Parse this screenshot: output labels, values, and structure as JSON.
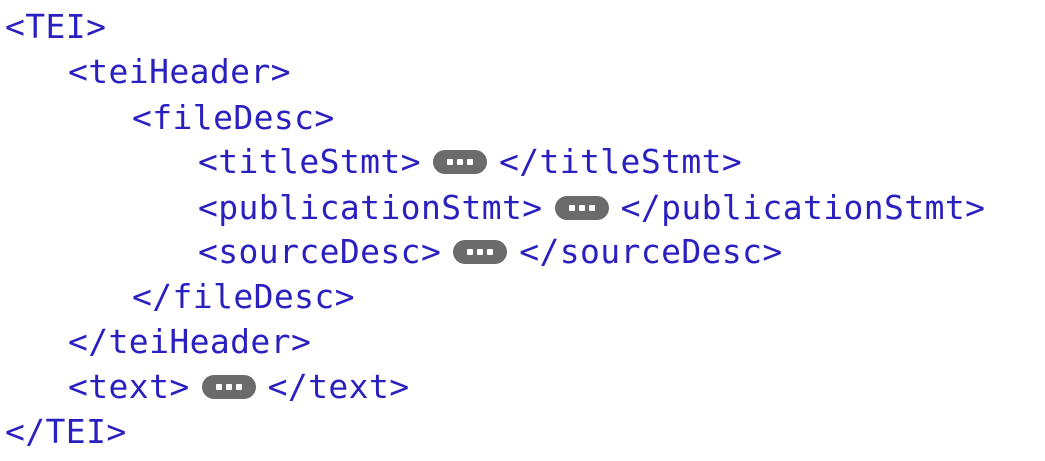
{
  "document": {
    "lines": [
      {
        "open": "<TEI>"
      },
      {
        "open": "<teiHeader>"
      },
      {
        "open": "<fileDesc>"
      },
      {
        "open": "<titleStmt>",
        "close": "</titleStmt>"
      },
      {
        "open": "<publicationStmt>",
        "close": "</publicationStmt>"
      },
      {
        "open": "<sourceDesc>",
        "close": "</sourceDesc>"
      },
      {
        "close": "</fileDesc>"
      },
      {
        "close": "</teiHeader>"
      },
      {
        "open": "<text>",
        "close": "</text>"
      },
      {
        "close": "</TEI>"
      }
    ]
  },
  "colors": {
    "tag_text": "#2a1fbf",
    "collapsed_badge": "#6b6b6b"
  },
  "icons": {
    "collapsed_content": "ellipsis-icon"
  }
}
